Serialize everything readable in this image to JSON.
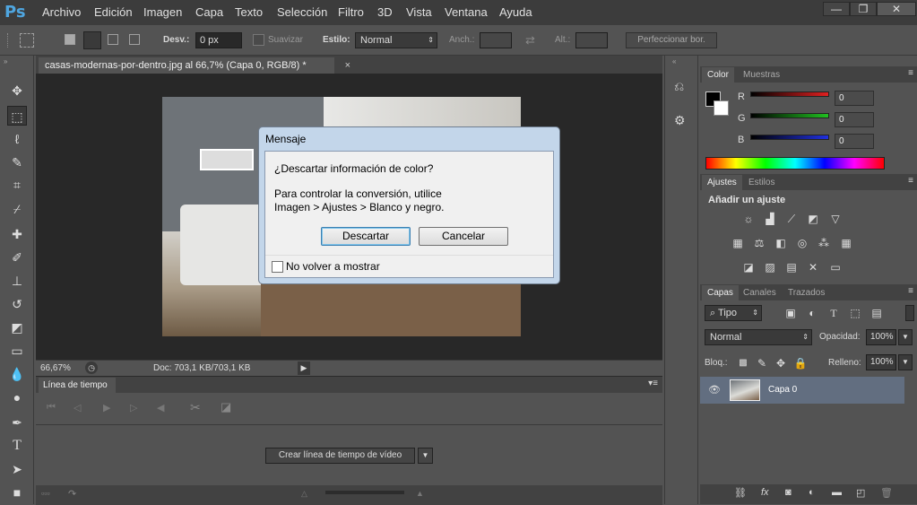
{
  "app": {
    "logo": "Ps"
  },
  "menu": [
    "Archivo",
    "Edición",
    "Imagen",
    "Capa",
    "Texto",
    "Selección",
    "Filtro",
    "3D",
    "Vista",
    "Ventana",
    "Ayuda"
  ],
  "window_controls": {
    "minimize": "—",
    "restore": "❐",
    "close": "✕"
  },
  "options": {
    "feather_label": "Desv.:",
    "feather_value": "0 px",
    "antialias_label": "Suavizar",
    "style_label": "Estilo:",
    "style_value": "Normal",
    "width_label": "Anch.:",
    "height_label": "Alt.:",
    "refine_label": "Perfeccionar bor."
  },
  "document": {
    "tab_title": "casas-modernas-por-dentro.jpg al 66,7% (Capa 0, RGB/8) *",
    "zoom": "66,67%",
    "doc_info": "Doc: 703,1 KB/703,1 KB"
  },
  "timeline": {
    "tab": "Línea de tiempo",
    "create_button": "Crear línea de tiempo de vídeo"
  },
  "color_panel": {
    "tabs": [
      "Color",
      "Muestras"
    ],
    "channels": [
      {
        "name": "R",
        "value": "0"
      },
      {
        "name": "G",
        "value": "0"
      },
      {
        "name": "B",
        "value": "0"
      }
    ]
  },
  "adjust_panel": {
    "tabs": [
      "Ajustes",
      "Estilos"
    ],
    "heading": "Añadir un ajuste"
  },
  "layers_panel": {
    "tabs": [
      "Capas",
      "Canales",
      "Trazados"
    ],
    "filter_label": "Tipo",
    "blend_mode": "Normal",
    "opacity_label": "Opacidad:",
    "opacity_value": "100%",
    "lock_label": "Bloq.:",
    "fill_label": "Relleno:",
    "fill_value": "100%",
    "layers": [
      {
        "name": "Capa 0"
      }
    ]
  },
  "dialog": {
    "title": "Mensaje",
    "question": "¿Descartar información de color?",
    "line1": "Para controlar la conversión, utilice",
    "line2": "Imagen > Ajustes > Blanco y negro.",
    "discard_button": "Descartar",
    "cancel_button": "Cancelar",
    "dont_show_label": "No volver a mostrar"
  },
  "colors": {
    "accent": "#4fa6e0",
    "dialog_frame": "#c3d6ea",
    "layer_selected": "#626e80"
  }
}
